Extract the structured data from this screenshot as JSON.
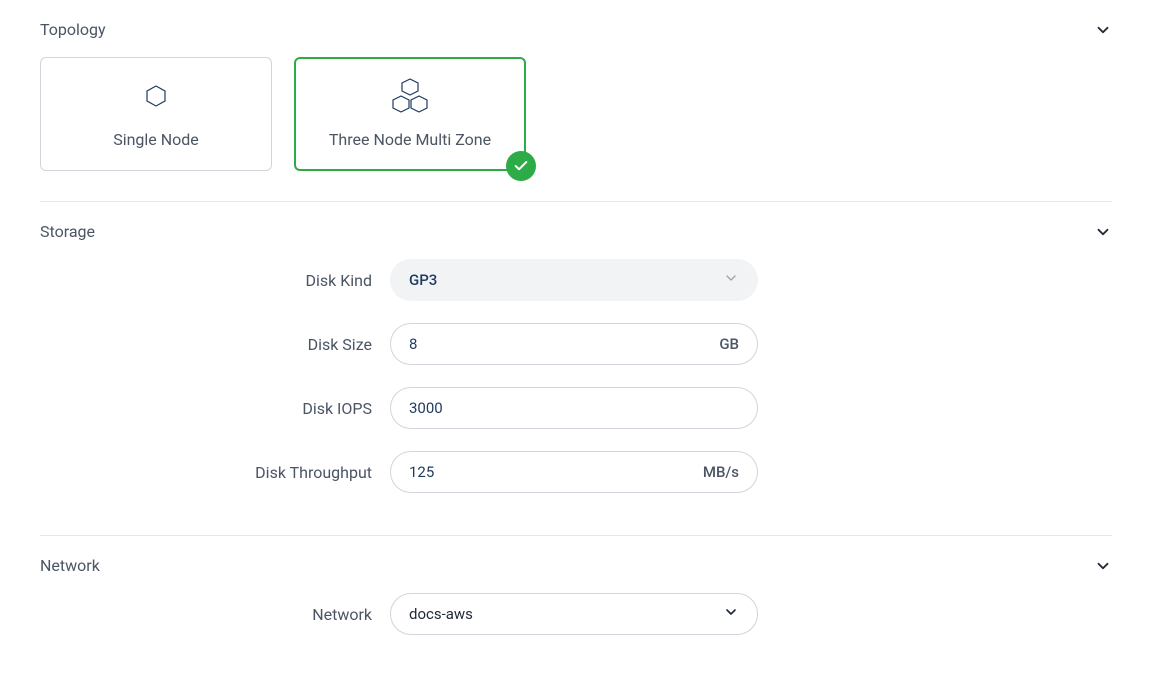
{
  "topology": {
    "title": "Topology",
    "options": [
      {
        "label": "Single Node",
        "selected": false
      },
      {
        "label": "Three Node Multi Zone",
        "selected": true
      }
    ]
  },
  "storage": {
    "title": "Storage",
    "disk_kind": {
      "label": "Disk Kind",
      "value": "GP3"
    },
    "disk_size": {
      "label": "Disk Size",
      "value": "8",
      "unit": "GB"
    },
    "disk_iops": {
      "label": "Disk IOPS",
      "value": "3000"
    },
    "disk_throughput": {
      "label": "Disk Throughput",
      "value": "125",
      "unit": "MB/s"
    }
  },
  "network": {
    "title": "Network",
    "field": {
      "label": "Network",
      "value": "docs-aws"
    }
  }
}
